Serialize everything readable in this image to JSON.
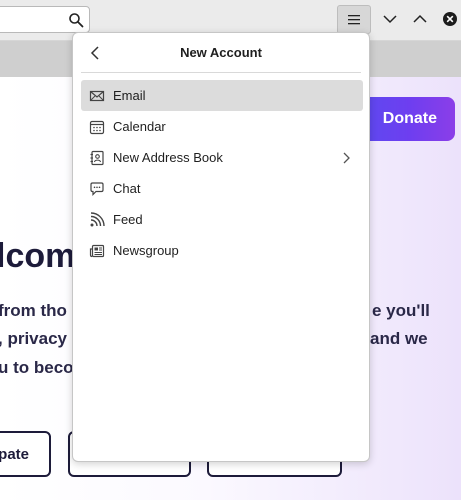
{
  "toolbar": {
    "search_icon": "search-icon",
    "menu_icon": "hamburger-menu-icon",
    "nav_icons": [
      "chevron-down-icon",
      "chevron-up-icon",
      "close-icon"
    ]
  },
  "page": {
    "donate_label": "Donate",
    "heading": "lcom",
    "paragraph_lines": [
      "from tho",
      "e you'll",
      ", privacy",
      "and we",
      "u to beco"
    ],
    "button_fragments": [
      "pate"
    ]
  },
  "panel": {
    "title": "New Account",
    "items": [
      {
        "label": "Email",
        "icon": "envelope-icon",
        "active": true,
        "submenu": false
      },
      {
        "label": "Calendar",
        "icon": "calendar-icon",
        "active": false,
        "submenu": false
      },
      {
        "label": "New Address Book",
        "icon": "address-book-icon",
        "active": false,
        "submenu": true
      },
      {
        "label": "Chat",
        "icon": "chat-bubble-icon",
        "active": false,
        "submenu": false
      },
      {
        "label": "Feed",
        "icon": "rss-feed-icon",
        "active": false,
        "submenu": false
      },
      {
        "label": "Newsgroup",
        "icon": "newsgroup-icon",
        "active": false,
        "submenu": false
      }
    ]
  },
  "colors": {
    "donate_gradient_start": "#5b4bf0",
    "donate_gradient_end": "#8b3ee8",
    "heading_text": "#1d1b3a",
    "active_item_bg": "#dcdcdc"
  }
}
